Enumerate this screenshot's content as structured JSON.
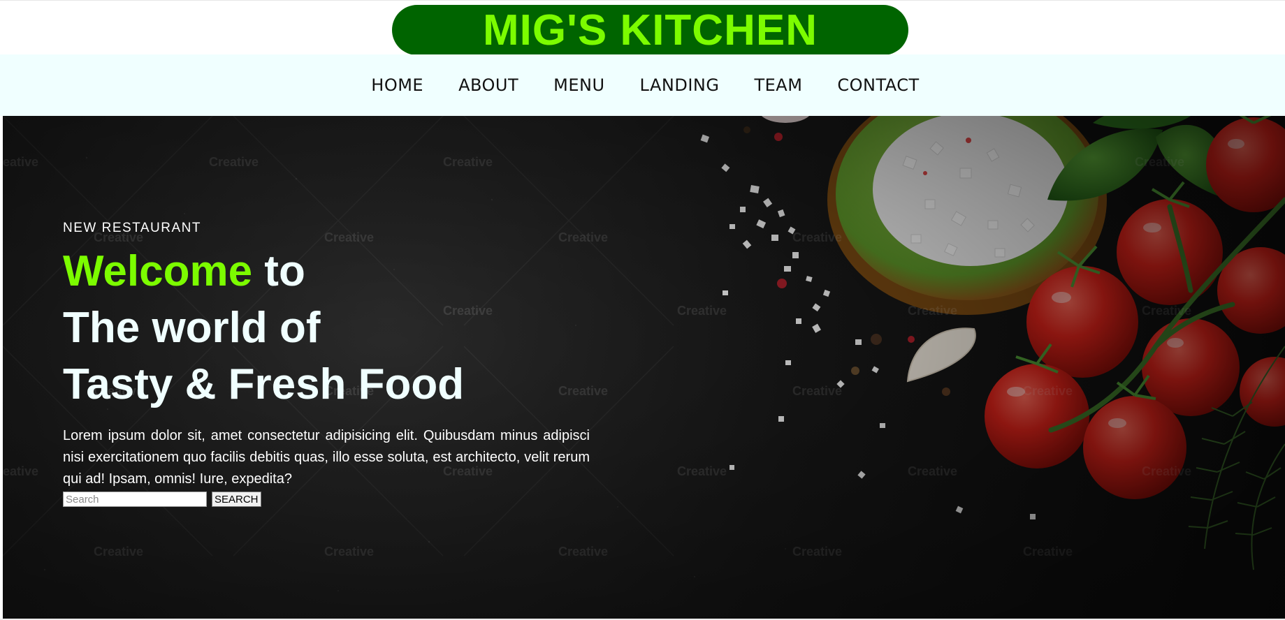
{
  "brand": {
    "title": "MIG'S KITCHEN"
  },
  "nav": {
    "items": [
      {
        "label": "HOME"
      },
      {
        "label": "ABOUT"
      },
      {
        "label": "MENU"
      },
      {
        "label": "LANDING"
      },
      {
        "label": "TEAM"
      },
      {
        "label": "CONTACT"
      }
    ]
  },
  "hero": {
    "eyebrow": "NEW RESTAURANT",
    "headline_accent": "Welcome",
    "headline_rest": " to",
    "headline_line2": "The world of",
    "headline_line3": "Tasty & Fresh Food",
    "description": "Lorem ipsum dolor sit, amet consectetur adipisicing elit. Quibusdam minus adipisci nisi exercitationem quo facilis debitis quas, illo esse soluta, est architecto, velit rerum qui ad! Ipsam, omnis! Iure, expedita?",
    "search": {
      "placeholder": "Search",
      "button_label": "SEARCH"
    },
    "watermark": "Creative"
  },
  "colors": {
    "brand_bg": "#006400",
    "brand_text": "#7cfc00",
    "nav_bg": "#f0ffff",
    "accent": "#7cfc00"
  }
}
